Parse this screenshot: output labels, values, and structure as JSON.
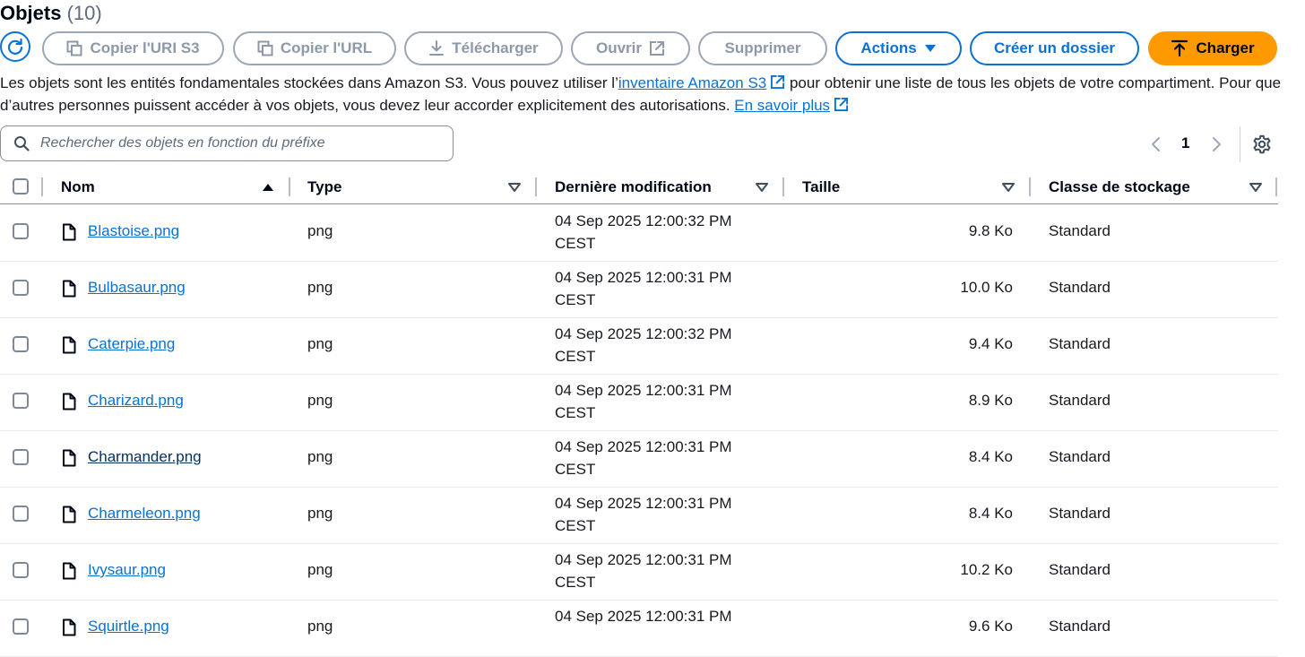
{
  "header": {
    "title": "Objets",
    "count": "(10)"
  },
  "toolbar": {
    "copy_uri": "Copier l'URI S3",
    "copy_url": "Copier l'URL",
    "download": "Télécharger",
    "open": "Ouvrir",
    "delete": "Supprimer",
    "actions": "Actions",
    "create_folder": "Créer un dossier",
    "upload": "Charger"
  },
  "description": {
    "part1": "Les objets sont les entités fondamentales stockées dans Amazon S3. Vous pouvez utiliser l’",
    "link1": "inventaire Amazon S3",
    "part2": " pour obtenir une liste de tous les objets de votre compartiment. Pour que d’autres personnes puissent accéder à vos objets, vous devez leur accorder explicitement des autorisations. ",
    "link2": "En savoir plus"
  },
  "search": {
    "placeholder": "Rechercher des objets en fonction du préfixe"
  },
  "pagination": {
    "current_page": "1"
  },
  "table": {
    "columns": {
      "name": "Nom",
      "type": "Type",
      "modified": "Dernière modification",
      "size": "Taille",
      "storage_class": "Classe de stockage"
    },
    "rows": [
      {
        "name": "Blastoise.png",
        "type": "png",
        "date_line1": "04 Sep 2025 12:00:32 PM",
        "date_line2": "CEST",
        "size": "9.8 Ko",
        "storage_class": "Standard"
      },
      {
        "name": "Bulbasaur.png",
        "type": "png",
        "date_line1": "04 Sep 2025 12:00:31 PM",
        "date_line2": "CEST",
        "size": "10.0 Ko",
        "storage_class": "Standard"
      },
      {
        "name": "Caterpie.png",
        "type": "png",
        "date_line1": "04 Sep 2025 12:00:32 PM",
        "date_line2": "CEST",
        "size": "9.4 Ko",
        "storage_class": "Standard"
      },
      {
        "name": "Charizard.png",
        "type": "png",
        "date_line1": "04 Sep 2025 12:00:31 PM",
        "date_line2": "CEST",
        "size": "8.9 Ko",
        "storage_class": "Standard"
      },
      {
        "name": "Charmander.png",
        "type": "png",
        "date_line1": "04 Sep 2025 12:00:31 PM",
        "date_line2": "CEST",
        "size": "8.4 Ko",
        "storage_class": "Standard"
      },
      {
        "name": "Charmeleon.png",
        "type": "png",
        "date_line1": "04 Sep 2025 12:00:31 PM",
        "date_line2": "CEST",
        "size": "8.4 Ko",
        "storage_class": "Standard"
      },
      {
        "name": "Ivysaur.png",
        "type": "png",
        "date_line1": "04 Sep 2025 12:00:31 PM",
        "date_line2": "CEST",
        "size": "10.2 Ko",
        "storage_class": "Standard"
      },
      {
        "name": "Squirtle.png",
        "type": "png",
        "date_line1": "04 Sep 2025 12:00:31 PM",
        "date_line2": "",
        "size": "9.6 Ko",
        "storage_class": "Standard"
      }
    ]
  },
  "colors": {
    "accent": "#0972d3",
    "primary_button": "#ff9900",
    "disabled": "#8d99a8"
  },
  "icons": [
    "refresh-icon",
    "copy-icon",
    "download-icon",
    "external-link-icon",
    "caret-down-icon",
    "upload-icon",
    "search-icon",
    "chevron-left-icon",
    "chevron-right-icon",
    "gear-icon",
    "file-icon",
    "sort-ascending-icon",
    "sort-descending-icon"
  ]
}
